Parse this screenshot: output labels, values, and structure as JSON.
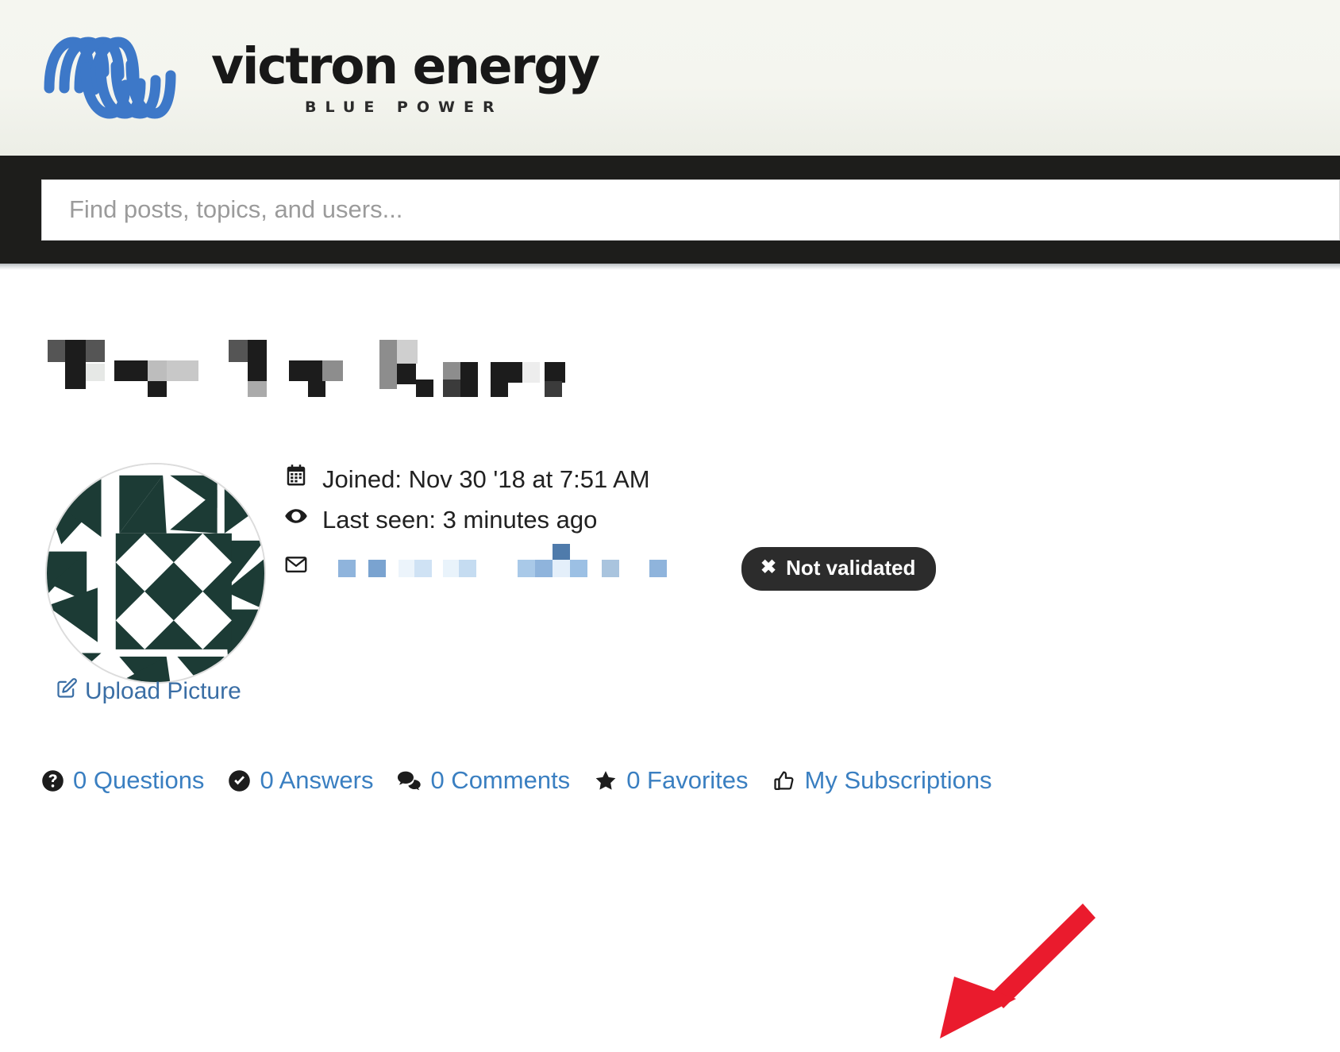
{
  "brand": {
    "logo_icon": "victron-coil-logo",
    "name": "victron energy",
    "tagline": "BLUE POWER",
    "logo_color": "#3d78c8",
    "wordmark_color": "#181818"
  },
  "search": {
    "placeholder": "Find posts, topics, and users...",
    "value": "",
    "bar_color": "#1d1d1b"
  },
  "profile": {
    "username_redacted": true,
    "avatar_icon": "geometric-identicon",
    "avatar_color": "#1c3b35",
    "upload_link": {
      "label": "Upload Picture",
      "icon": "edit-pencil-square-icon"
    },
    "meta": [
      {
        "icon": "calendar-icon",
        "label": "Joined: Nov 30 '18 at 7:51 AM"
      },
      {
        "icon": "eye-icon",
        "label": "Last seen: 3 minutes ago"
      }
    ],
    "email": {
      "icon": "envelope-icon",
      "value_redacted": true,
      "badge": {
        "icon": "x-mark-icon",
        "glyph": "✖",
        "label": "Not validated",
        "background": "#2c2c2c",
        "color": "#ffffff"
      }
    }
  },
  "stats": [
    {
      "icon": "question-circle-icon",
      "label": "0 Questions",
      "count": 0
    },
    {
      "icon": "check-circle-icon",
      "label": "0 Answers",
      "count": 0
    },
    {
      "icon": "comments-icon",
      "label": "0 Comments",
      "count": 0
    },
    {
      "icon": "star-icon",
      "label": "0 Favorites",
      "count": 0
    },
    {
      "icon": "thumbs-up-icon",
      "label": "My Subscriptions",
      "count": null
    }
  ],
  "annotation": {
    "type": "arrow",
    "color": "#ea1b2d",
    "points_to": "My Subscriptions"
  },
  "link_color": "#3a7fc1"
}
